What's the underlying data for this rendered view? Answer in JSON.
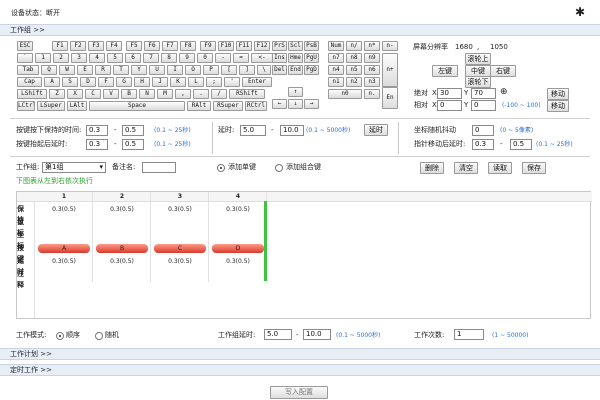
{
  "header": {
    "status": "设备状态：断开"
  },
  "bars": {
    "work_group": "工作组 >>",
    "work_plan": "工作计划 >>",
    "timed_work": "定时工作 >>"
  },
  "keyboard": {
    "row1": [
      "ESC",
      "F1",
      "F2",
      "F3",
      "F4",
      "F5",
      "F6",
      "F7",
      "F8",
      "F9",
      "F10",
      "F11",
      "F12"
    ],
    "row2": [
      "`",
      "1",
      "2",
      "3",
      "4",
      "5",
      "6",
      "7",
      "8",
      "9",
      "0",
      "-",
      "=",
      "<-"
    ],
    "row3": [
      "Tab",
      "Q",
      "W",
      "E",
      "R",
      "T",
      "Y",
      "U",
      "I",
      "O",
      "P",
      "[",
      "]",
      "\\"
    ],
    "row4": [
      "Cap",
      "A",
      "S",
      "D",
      "F",
      "G",
      "H",
      "J",
      "K",
      "L",
      ";",
      "'",
      "Enter"
    ],
    "row5": [
      "LShift",
      "Z",
      "X",
      "C",
      "V",
      "B",
      "N",
      "M",
      ",",
      ".",
      "/",
      "RShift"
    ],
    "row6": [
      "LCtrl",
      "LSuper",
      "LAlt",
      "Space",
      "RAlt",
      "RSuper",
      "RCtrl"
    ],
    "nav": [
      "PrS",
      "Scl",
      "PsB",
      "Ins",
      "Hme",
      "PgU",
      "Del",
      "End",
      "PgD"
    ],
    "arrows": [
      "↑",
      "←",
      "↓",
      "→"
    ],
    "numpad": [
      "Num",
      "n/",
      "n*",
      "n7",
      "n8",
      "n9",
      "n4",
      "n5",
      "n6",
      "n1",
      "n2",
      "n3",
      "n0",
      "n.",
      "n-",
      "n+",
      "En"
    ]
  },
  "screen": {
    "res_label": "屏幕分辨率",
    "res_w": "1680",
    "comma": ",",
    "res_h": "1050",
    "wheel_up": "滚轮上",
    "left": "左键",
    "middle": "中键",
    "right": "右键",
    "wheel_down": "滚轮下",
    "abs_label": "绝对",
    "x_label": "X",
    "y_label": "Y",
    "abs_x": "30",
    "abs_y": "70",
    "move": "移动",
    "rel_label": "相对",
    "rel_x": "0",
    "rel_y": "0",
    "rel_hint": "(-100 ~ 100)",
    "move2": "移动"
  },
  "timing": {
    "hold_label": "按键按下保持的时间:",
    "hold_min": "0.3",
    "dash": "-",
    "hold_max": "0.5",
    "hold_hint": "(0.1 ~ 25秒)",
    "after_label": "按键抬起后延时:",
    "after_min": "0.3",
    "after_max": "0.5",
    "after_hint": "(0.1 ~ 25秒)",
    "delay_label": "延时:",
    "delay_min": "5.0",
    "delay_max": "10.0",
    "delay_hint": "(0.1 ~ 5000秒)",
    "delay_btn": "延时",
    "coord_label": "坐标随机抖动",
    "coord_val": "0",
    "coord_hint": "(0 ~ 5像素)",
    "ptr_label": "指针移动后延时:",
    "ptr_min": "0.3",
    "ptr_max": "0.5",
    "ptr_hint": "(0.1 ~ 25秒)"
  },
  "group": {
    "label": "工作组:",
    "select": "第1组",
    "note_label": "备注名:",
    "add_single": "添加单键",
    "add_combo": "添加组合键",
    "delete": "删除",
    "clear": "清空",
    "read": "读取",
    "save": "保存",
    "tip": "下图表从左到右依次执行"
  },
  "table": {
    "cols": [
      "1",
      "2",
      "3",
      "4"
    ],
    "rows": [
      "保持",
      "鼠标",
      "坐标",
      "按键",
      "延时",
      "注释"
    ],
    "hold": [
      "0.3(0.5)",
      "0.3(0.5)",
      "0.3(0.5)",
      "0.3(0.5)"
    ],
    "keys": [
      "A",
      "B",
      "C",
      "D"
    ],
    "delay": [
      "0.3(0.5)",
      "0.3(0.5)",
      "0.3(0.5)",
      "0.3(0.5)"
    ]
  },
  "bottom": {
    "mode_label": "工作模式:",
    "seq": "顺序",
    "rand": "随机",
    "grp_delay_label": "工作组延时:",
    "gd_min": "5.0",
    "gd_max": "10.0",
    "gd_hint": "(0.1 ~ 5000秒)",
    "count_label": "工作次数:",
    "count_val": "1",
    "count_hint": "(1 ~ 50000)"
  },
  "footer": {
    "write": "写入配置"
  },
  "colors": {
    "accent_blue": "#2a6fd6",
    "key_red": "#d83a2a",
    "green_marker": "#3ec43e"
  }
}
